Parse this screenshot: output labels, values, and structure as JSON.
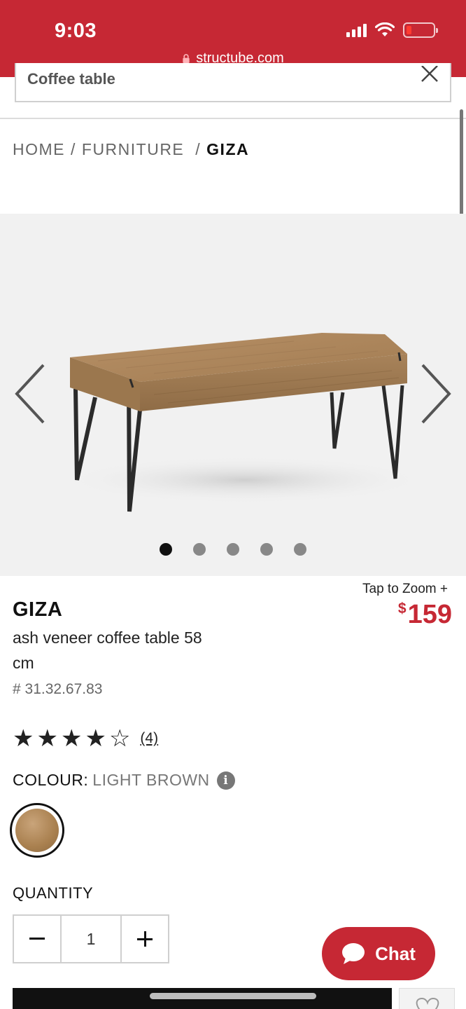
{
  "status_bar": {
    "time": "9:03"
  },
  "browser": {
    "url": "structube.com"
  },
  "search": {
    "value": "Coffee table"
  },
  "breadcrumb": {
    "items": [
      "HOME",
      "FURNITURE",
      "GIZA"
    ]
  },
  "carousel": {
    "slide_count": 5,
    "active_index": 0
  },
  "product": {
    "tap_to_zoom": "Tap to Zoom +",
    "currency_symbol": "$",
    "price": "159",
    "name": "GIZA",
    "description": "ash veneer coffee table 58 cm",
    "sku": "# 31.32.67.83",
    "rating": 4,
    "rating_max": 5,
    "review_count": "(4)",
    "colour_label": "COLOUR:",
    "colour_value": "LIGHT BROWN",
    "quantity_label": "QUANTITY",
    "quantity": "1"
  },
  "chat": {
    "label": "Chat"
  },
  "colors": {
    "brand_red": "#c62834",
    "swatch": "#b08a5c"
  }
}
